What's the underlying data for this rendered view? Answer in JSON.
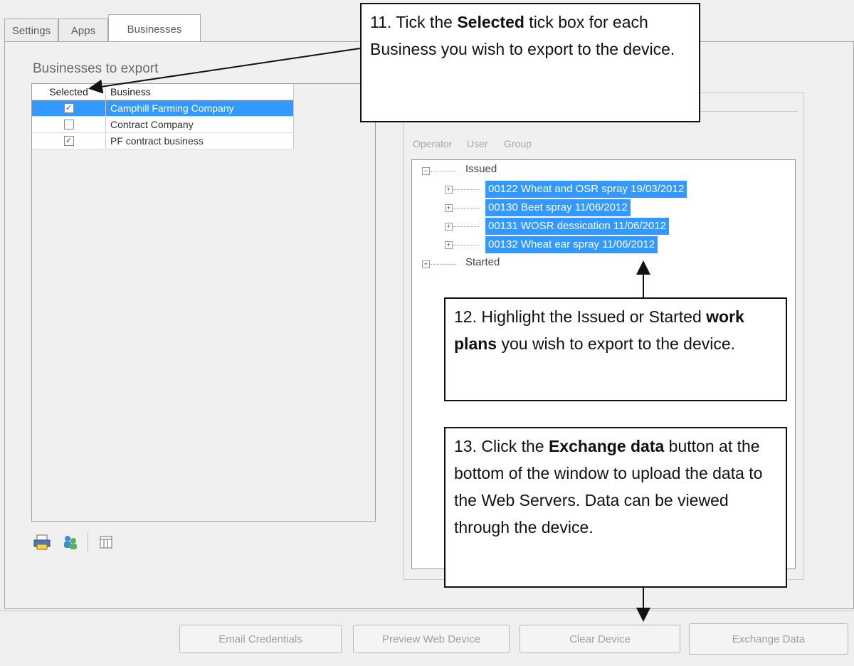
{
  "tabs": [
    {
      "label": "Settings"
    },
    {
      "label": "Apps"
    },
    {
      "label": "Businesses",
      "active": true
    }
  ],
  "businesses": {
    "section_label": "Businesses to export",
    "columns": [
      "Selected",
      "Business"
    ],
    "rows": [
      {
        "selected": true,
        "name": "Camphill Farming Company",
        "highlighted": true
      },
      {
        "selected": false,
        "name": "Contract Company",
        "highlighted": false
      },
      {
        "selected": true,
        "name": "PF contract business",
        "highlighted": false
      }
    ]
  },
  "toolbar": {
    "icons": [
      "printer-icon",
      "people-sync-icon",
      "columns-icon"
    ]
  },
  "work_plans": {
    "radio_options": [
      "Operator",
      "User",
      "Group"
    ],
    "tree": {
      "issued_label": "Issued",
      "issued_items": [
        "00122 Wheat and OSR spray 19/03/2012",
        "00130 Beet spray 11/06/2012",
        "00131 WOSR dessication 11/06/2012",
        "00132 Wheat ear spray 11/06/2012"
      ],
      "started_label": "Started"
    }
  },
  "buttons": {
    "email_credentials": "Email Credentials",
    "preview_web_device": "Preview Web Device",
    "clear_device": "Clear Device",
    "exchange_data": "Exchange Data"
  },
  "callouts": {
    "c11": {
      "a": "11. Tick the ",
      "b": "Selected",
      "c": " tick box for each Business you wish to export to the device."
    },
    "c12": {
      "a": "12. Highlight the Issued or Started ",
      "b": "work plans",
      "c": " you wish to export to the device."
    },
    "c13": {
      "a": "13. Click the ",
      "b": "Exchange data",
      "c": " button at the bottom of the window to upload the data to the Web Servers. Data can be viewed through the device."
    }
  },
  "colors": {
    "selection": "#3399ff",
    "window_bg": "#efefef"
  }
}
